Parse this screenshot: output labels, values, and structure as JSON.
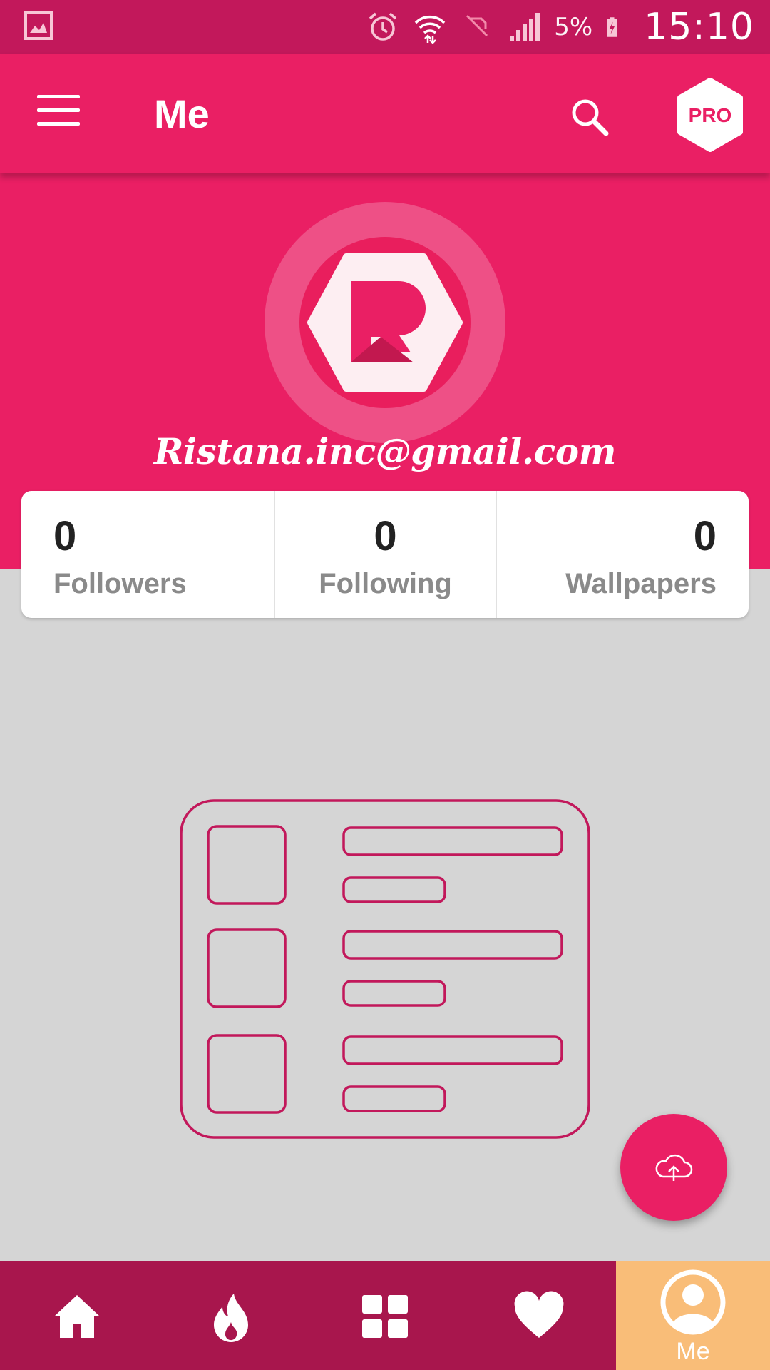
{
  "status_bar": {
    "battery_percent": "5%",
    "time": "15:10",
    "icons": [
      "gallery-icon",
      "alarm-icon",
      "wifi-icon",
      "no-sim-icon",
      "signal-icon",
      "battery-charging-icon"
    ]
  },
  "app_bar": {
    "title": "Me",
    "pro_badge": "PRO"
  },
  "profile": {
    "email": "Ristana.inc@gmail.com",
    "avatar_logo": "R"
  },
  "stats": [
    {
      "value": "0",
      "label": "Followers"
    },
    {
      "value": "0",
      "label": "Following"
    },
    {
      "value": "0",
      "label": "Wallpapers"
    }
  ],
  "fab": {
    "icon": "cloud-upload-icon"
  },
  "bottom_nav": {
    "items": [
      {
        "icon": "home-icon"
      },
      {
        "icon": "flame-icon"
      },
      {
        "icon": "grid-icon"
      },
      {
        "icon": "heart-icon"
      },
      {
        "icon": "user-icon",
        "label": "Me",
        "active": true
      }
    ]
  },
  "colors": {
    "status_bar": "#c2185b",
    "primary": "#ea1f64",
    "bottom_nav": "#a8164d",
    "active_tab": "#f9bd78",
    "background": "#d5d5d5",
    "illustration_stroke": "#c2185b"
  }
}
